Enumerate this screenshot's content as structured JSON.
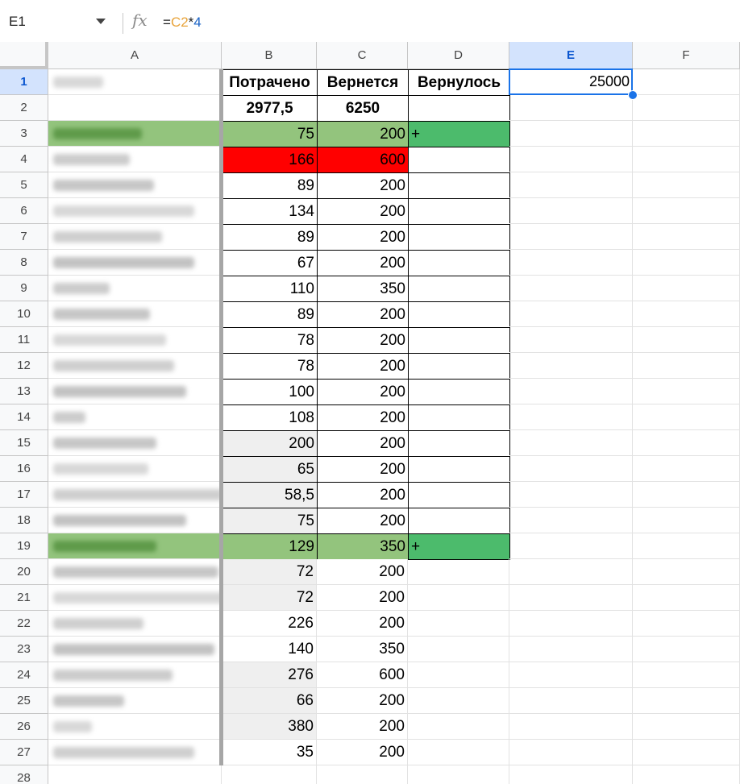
{
  "formula_bar": {
    "cell_ref": "E1",
    "fx_label": "fx",
    "formula_prefix": "=",
    "formula_ref": "C2",
    "formula_op": "*",
    "formula_num": "4"
  },
  "columns": [
    "A",
    "B",
    "C",
    "D",
    "E",
    "F"
  ],
  "selected_cell": "E1",
  "rows": [
    {
      "n": "1",
      "a_blur": true,
      "b": "Потрачено",
      "c": "Вернется",
      "d": "Вернулось",
      "e": "25000",
      "style": "header"
    },
    {
      "n": "2",
      "a_blur": false,
      "b": "2977,5",
      "c": "6250",
      "d": "",
      "e": "",
      "style": "totals"
    },
    {
      "n": "3",
      "b": "75",
      "c": "200",
      "d": "+",
      "style": "green"
    },
    {
      "n": "4",
      "b": "166",
      "c": "600",
      "d": "",
      "style": "red"
    },
    {
      "n": "5",
      "b": "89",
      "c": "200",
      "d": ""
    },
    {
      "n": "6",
      "b": "134",
      "c": "200",
      "d": ""
    },
    {
      "n": "7",
      "b": "89",
      "c": "200",
      "d": ""
    },
    {
      "n": "8",
      "b": "67",
      "c": "200",
      "d": ""
    },
    {
      "n": "9",
      "b": "110",
      "c": "350",
      "d": ""
    },
    {
      "n": "10",
      "b": "89",
      "c": "200",
      "d": ""
    },
    {
      "n": "11",
      "b": "78",
      "c": "200",
      "d": ""
    },
    {
      "n": "12",
      "b": "78",
      "c": "200",
      "d": ""
    },
    {
      "n": "13",
      "b": "100",
      "c": "200",
      "d": ""
    },
    {
      "n": "14",
      "b": "108",
      "c": "200",
      "d": ""
    },
    {
      "n": "15",
      "b": "200",
      "c": "200",
      "d": "",
      "style": "grayb"
    },
    {
      "n": "16",
      "b": "65",
      "c": "200",
      "d": "",
      "style": "grayb"
    },
    {
      "n": "17",
      "b": "58,5",
      "c": "200",
      "d": "",
      "style": "grayb"
    },
    {
      "n": "18",
      "b": "75",
      "c": "200",
      "d": "",
      "style": "grayb"
    },
    {
      "n": "19",
      "b": "129",
      "c": "350",
      "d": "+",
      "style": "green"
    },
    {
      "n": "20",
      "b": "72",
      "c": "200",
      "style": "open_grayb"
    },
    {
      "n": "21",
      "b": "72",
      "c": "200",
      "style": "open_grayb"
    },
    {
      "n": "22",
      "b": "226",
      "c": "200",
      "style": "open"
    },
    {
      "n": "23",
      "b": "140",
      "c": "350",
      "style": "open"
    },
    {
      "n": "24",
      "b": "276",
      "c": "600",
      "style": "open_grayb"
    },
    {
      "n": "25",
      "b": "66",
      "c": "200",
      "style": "open_grayb"
    },
    {
      "n": "26",
      "b": "380",
      "c": "200",
      "style": "open_grayb"
    },
    {
      "n": "27",
      "b": "35",
      "c": "200",
      "style": "open"
    },
    {
      "n": "28",
      "b": "",
      "c": "",
      "style": "empty"
    }
  ],
  "colors": {
    "green_row": "#93c47d",
    "green_plus": "#4cbb6c",
    "red_row": "#ff0000",
    "gray_fill": "#efefef",
    "selection": "#1a73e8"
  }
}
